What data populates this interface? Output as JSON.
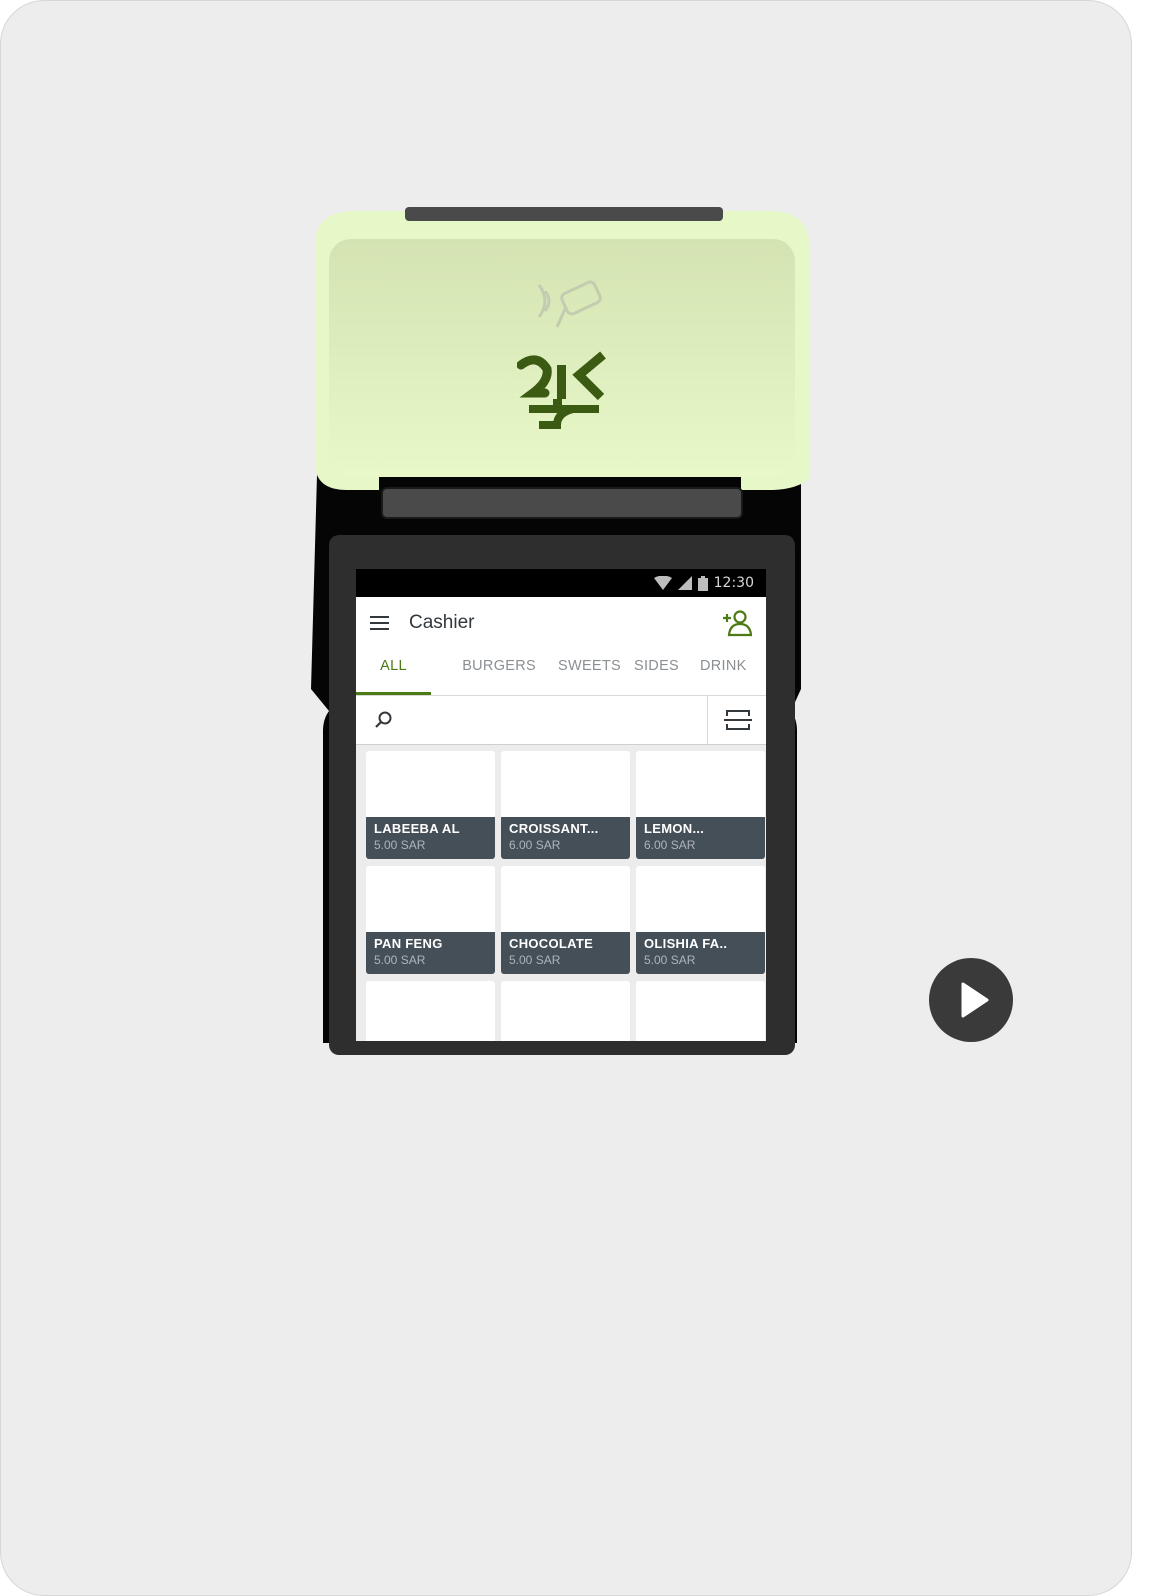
{
  "status_bar": {
    "time": "12:30"
  },
  "app_bar": {
    "title": "Cashier"
  },
  "tabs": [
    {
      "label": "ALL",
      "active": true
    },
    {
      "label": "BURGERS",
      "active": false
    },
    {
      "label": "SWEETS",
      "active": false
    },
    {
      "label": "SIDES",
      "active": false
    },
    {
      "label": "DRINK",
      "active": false
    }
  ],
  "search": {
    "placeholder": ""
  },
  "products": [
    {
      "name": "LABEEBA AL",
      "price": "5.00 SAR"
    },
    {
      "name": "CROISSANT...",
      "price": "6.00 SAR"
    },
    {
      "name": "LEMON...",
      "price": "6.00 SAR"
    },
    {
      "name": "PAN FENG",
      "price": "5.00 SAR"
    },
    {
      "name": "CHOCOLATE",
      "price": "5.00 SAR"
    },
    {
      "name": "OLISHIA FA..",
      "price": "5.00 SAR"
    }
  ],
  "icons": {
    "menu": "menu-icon",
    "add_customer": "add-user-icon",
    "search": "search-icon",
    "scanner": "scan-icon",
    "nfc": "contactless-icon",
    "play": "play-icon"
  },
  "colors": {
    "accent": "#4c7a14",
    "tile_label_bg": "#454f58",
    "device_top": "#e6f7c8"
  }
}
